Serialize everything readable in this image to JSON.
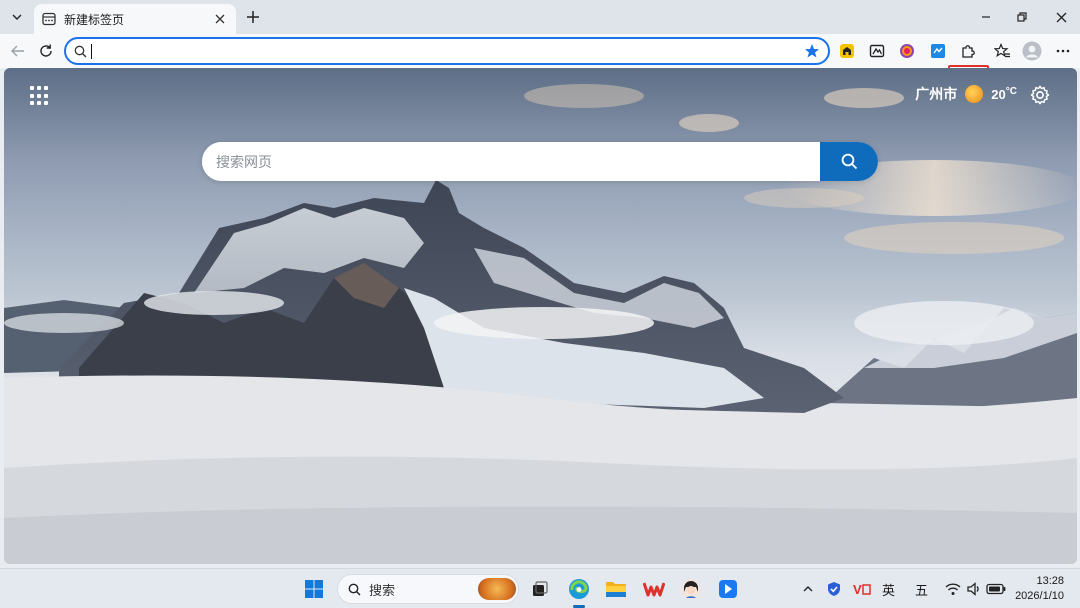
{
  "tab": {
    "title": "新建标签页"
  },
  "address": {
    "value": "",
    "placeholder": ""
  },
  "header": {
    "city": "广州市",
    "temperature": "20",
    "unit": "°C"
  },
  "search": {
    "placeholder": "搜索网页"
  },
  "taskbar": {
    "search_label": "搜索",
    "ime_lang": "英",
    "ime_mode": "五",
    "time": "13:28",
    "date": "2026/1/10"
  },
  "colors": {
    "accent": "#0f6cbd",
    "highlight_box": "#e0302c",
    "favorite_star": "#1a73e8"
  },
  "icons": {
    "toolbar": [
      "back-icon",
      "refresh-icon",
      "search-icon",
      "favorite-star-icon",
      "extension-home-icon",
      "extension-puzzle-icon",
      "extension-color-icon",
      "extension-screenshot-icon",
      "extensions-icon",
      "favorites-icon",
      "profile-avatar-icon",
      "more-icon"
    ],
    "taskbar": [
      "windows-start-icon",
      "search-icon",
      "task-view-icon",
      "edge-icon",
      "file-explorer-icon",
      "wps-icon",
      "avatar-app-icon",
      "feishu-icon",
      "chevron-up-icon",
      "security-shield-icon",
      "antivirus-icon",
      "wifi-icon",
      "volume-icon",
      "battery-icon"
    ]
  }
}
